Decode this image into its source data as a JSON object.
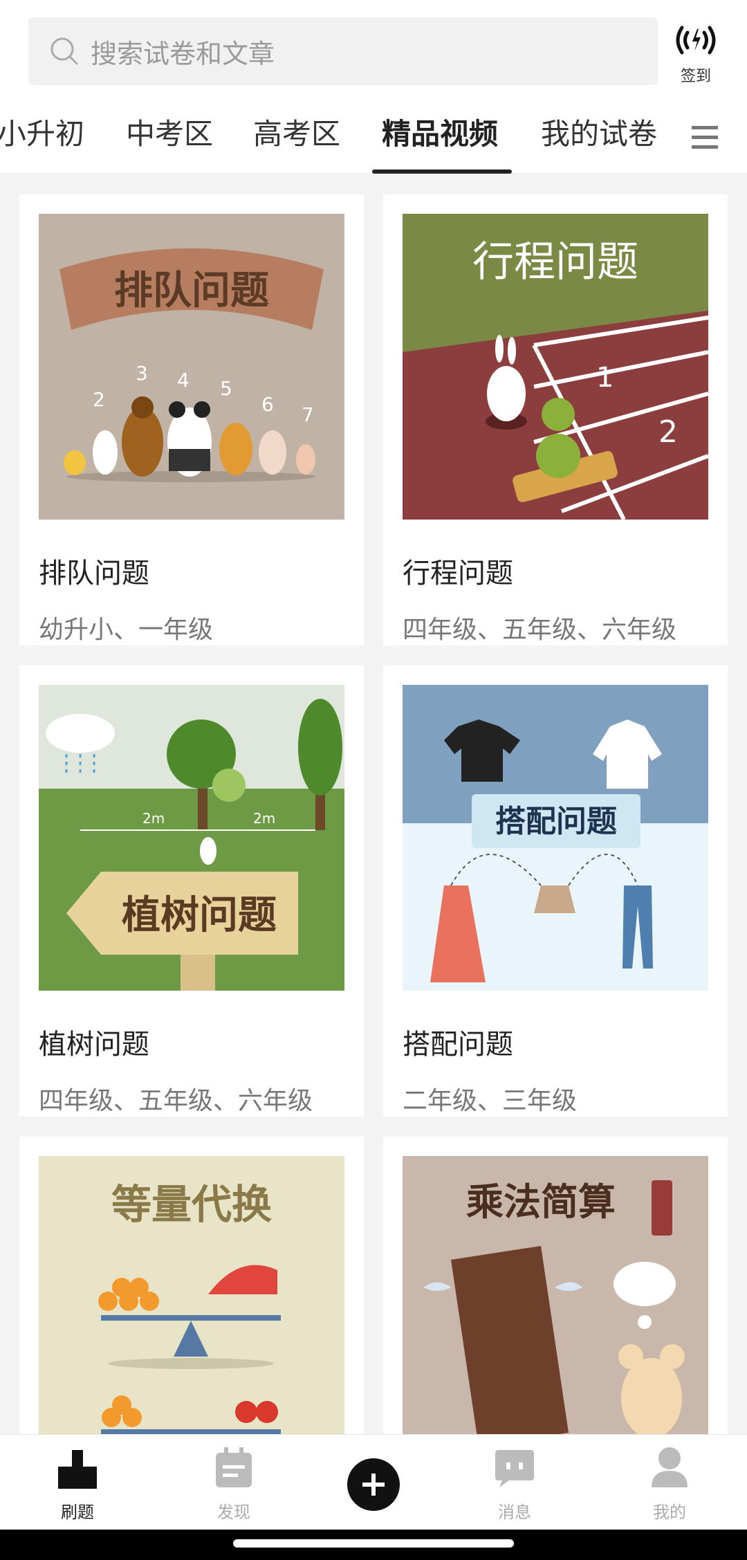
{
  "search": {
    "placeholder": "搜索试卷和文章"
  },
  "checkin": {
    "label": "签到"
  },
  "tabs": [
    {
      "label": "小升初"
    },
    {
      "label": "中考区"
    },
    {
      "label": "高考区"
    },
    {
      "label": "精品视频",
      "active": true
    },
    {
      "label": "我的试卷"
    }
  ],
  "cards": [
    {
      "title": "排队问题",
      "grades": "幼升小、一年级",
      "image_text": "排队问题"
    },
    {
      "title": "行程问题",
      "grades": "四年级、五年级、六年级",
      "image_text": "行程问题"
    },
    {
      "title": "植树问题",
      "grades": "四年级、五年级、六年级",
      "image_text": "植树问题"
    },
    {
      "title": "搭配问题",
      "grades": "二年级、三年级",
      "image_text": "搭配问题"
    },
    {
      "title": "等量代换",
      "grades": "",
      "image_text": "等量代换"
    },
    {
      "title": "乘法简算",
      "grades": "",
      "image_text": "乘法简算"
    }
  ],
  "bottom_nav": [
    {
      "label": "刷题",
      "icon": "brush-icon",
      "active": true
    },
    {
      "label": "发现",
      "icon": "calendar-icon"
    },
    {
      "label": "",
      "icon": "plus-icon"
    },
    {
      "label": "消息",
      "icon": "chat-icon"
    },
    {
      "label": "我的",
      "icon": "person-icon"
    }
  ],
  "colors": {
    "accent": "#222222",
    "inactive": "#aaaaaa"
  }
}
